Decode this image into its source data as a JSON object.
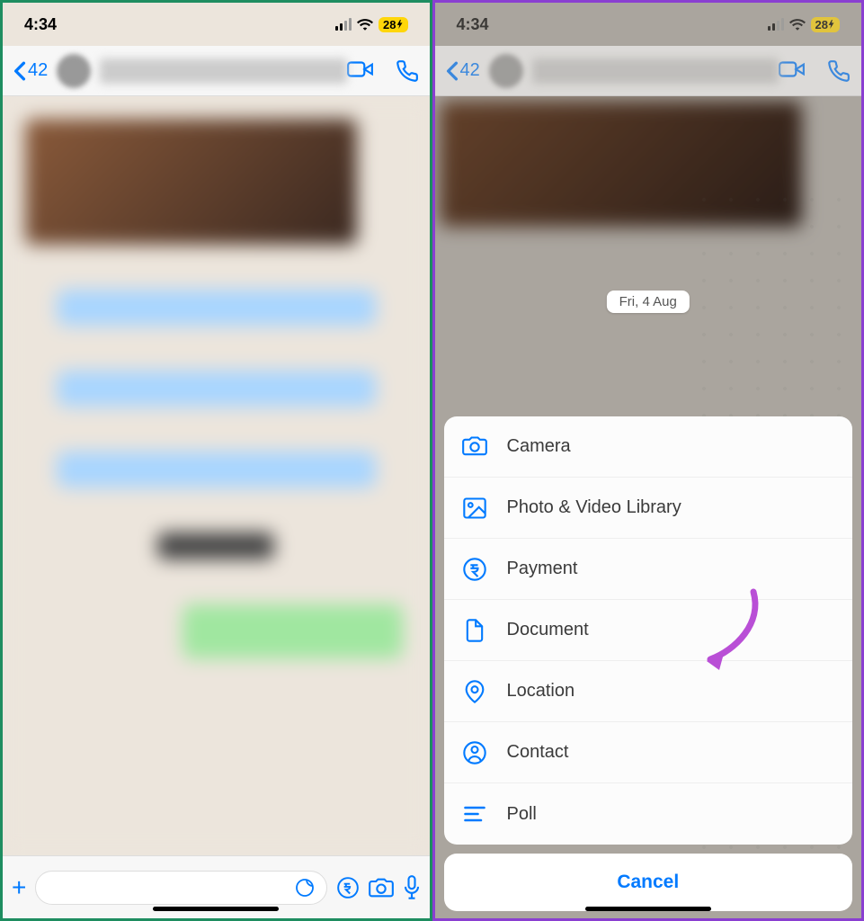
{
  "status": {
    "time": "4:34",
    "battery": "28"
  },
  "header": {
    "back_count": "42"
  },
  "date_chip": "Fri, 4 Aug",
  "sheet": {
    "items": [
      {
        "label": "Camera"
      },
      {
        "label": "Photo & Video Library"
      },
      {
        "label": "Payment"
      },
      {
        "label": "Document"
      },
      {
        "label": "Location"
      },
      {
        "label": "Contact"
      },
      {
        "label": "Poll"
      }
    ],
    "cancel": "Cancel"
  }
}
